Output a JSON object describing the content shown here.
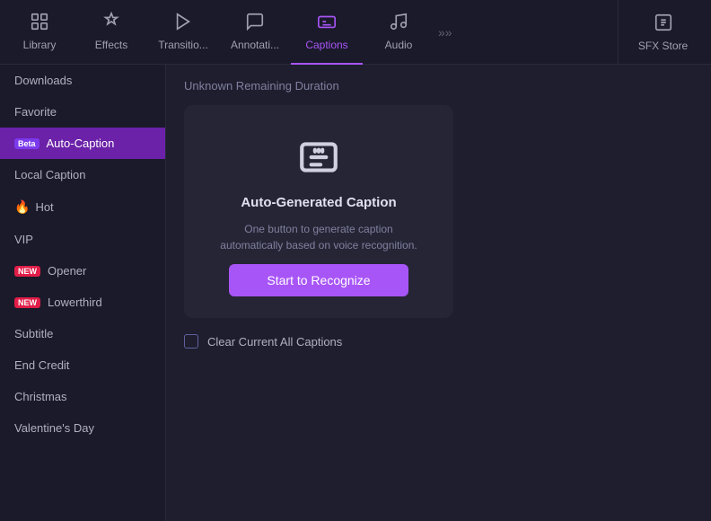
{
  "topNav": {
    "items": [
      {
        "id": "library",
        "label": "Library",
        "icon": "library",
        "active": false
      },
      {
        "id": "effects",
        "label": "Effects",
        "icon": "effects",
        "active": false
      },
      {
        "id": "transitions",
        "label": "Transitio...",
        "icon": "transitions",
        "active": false
      },
      {
        "id": "annotations",
        "label": "Annotati...",
        "icon": "annotations",
        "active": false
      },
      {
        "id": "captions",
        "label": "Captions",
        "icon": "captions",
        "active": true
      },
      {
        "id": "audio",
        "label": "Audio",
        "icon": "audio",
        "active": false
      }
    ],
    "sfxStore": "SFX Store"
  },
  "sidebar": {
    "items": [
      {
        "id": "downloads",
        "label": "Downloads",
        "badge": null,
        "icon": null
      },
      {
        "id": "favorite",
        "label": "Favorite",
        "badge": null,
        "icon": null
      },
      {
        "id": "auto-caption",
        "label": "Auto-Caption",
        "badge": "Beta",
        "badgeType": "beta",
        "active": true
      },
      {
        "id": "local-caption",
        "label": "Local Caption",
        "badge": null,
        "icon": null
      },
      {
        "id": "hot",
        "label": "Hot",
        "badge": null,
        "icon": "fire"
      },
      {
        "id": "vip",
        "label": "VIP",
        "badge": null,
        "icon": null
      },
      {
        "id": "opener",
        "label": "Opener",
        "badge": "NEW",
        "badgeType": "new"
      },
      {
        "id": "lowerthird",
        "label": "Lowerthird",
        "badge": "NEW",
        "badgeType": "new"
      },
      {
        "id": "subtitle",
        "label": "Subtitle",
        "badge": null,
        "icon": null
      },
      {
        "id": "end-credit",
        "label": "End Credit",
        "badge": null,
        "icon": null
      },
      {
        "id": "christmas",
        "label": "Christmas",
        "badge": null,
        "icon": null
      },
      {
        "id": "valentines",
        "label": "Valentine's Day",
        "badge": null,
        "icon": null
      }
    ]
  },
  "content": {
    "statusText": "Unknown Remaining Duration",
    "card": {
      "title": "Auto-Generated Caption",
      "description": "One button to generate caption automatically based on voice recognition.",
      "buttonLabel": "Start to Recognize"
    },
    "checkboxLabel": "Clear Current All Captions"
  }
}
